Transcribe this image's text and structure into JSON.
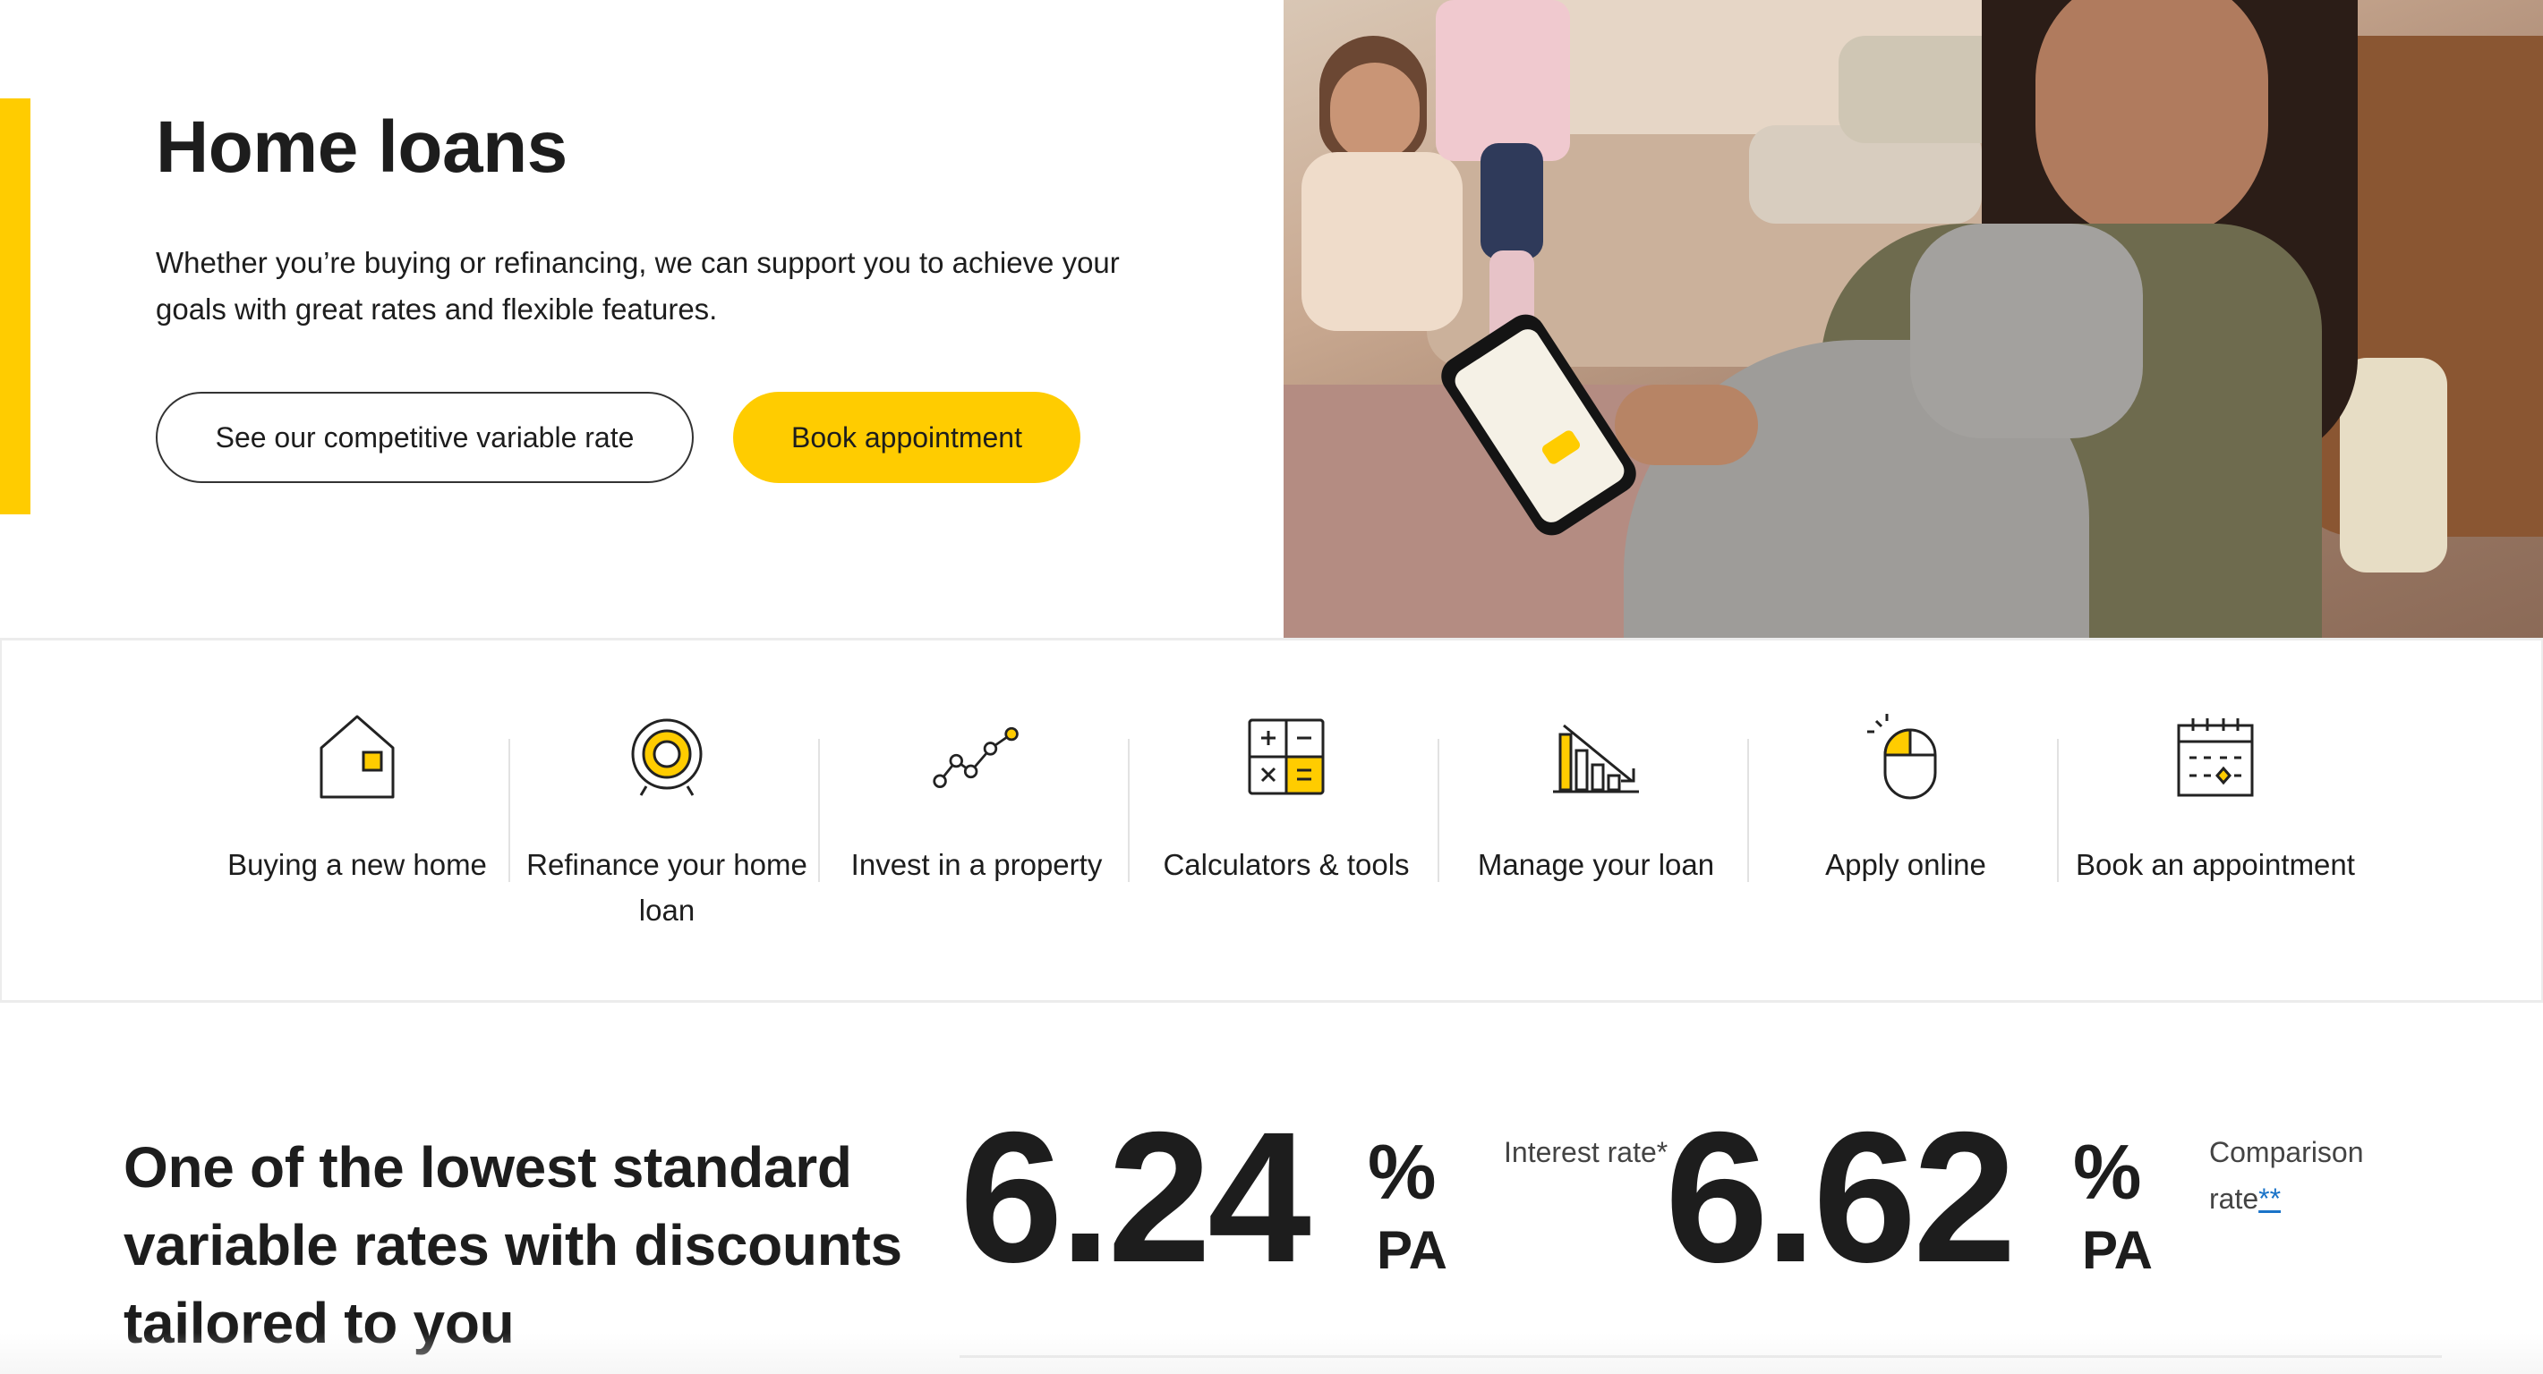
{
  "hero": {
    "title": "Home loans",
    "description": "Whether you’re buying or refinancing, we can support you to achieve your goals with great rates and flexible features.",
    "secondary_button": "See our competitive variable rate",
    "primary_button": "Book appointment",
    "accent_color": "#ffcc00"
  },
  "quick_links": [
    {
      "label": "Buying a new home",
      "icon": "house-icon"
    },
    {
      "label": "Refinance your home loan",
      "icon": "target-icon"
    },
    {
      "label": "Invest in a property",
      "icon": "growth-chart-icon"
    },
    {
      "label": "Calculators & tools",
      "icon": "calculator-icon"
    },
    {
      "label": "Manage your loan",
      "icon": "declining-bars-icon"
    },
    {
      "label": "Apply online",
      "icon": "mouse-click-icon"
    },
    {
      "label": "Book an appointment",
      "icon": "calendar-icon"
    }
  ],
  "rates": {
    "title": "One of the lowest standard variable rates with discounts tailored to you",
    "interest": {
      "value": "6.24",
      "percent": "%",
      "pa": "PA",
      "label": "Interest rate*"
    },
    "comparison": {
      "value": "6.62",
      "percent": "%",
      "pa": "PA",
      "label": "Comparison rate",
      "footnote": "**"
    }
  }
}
